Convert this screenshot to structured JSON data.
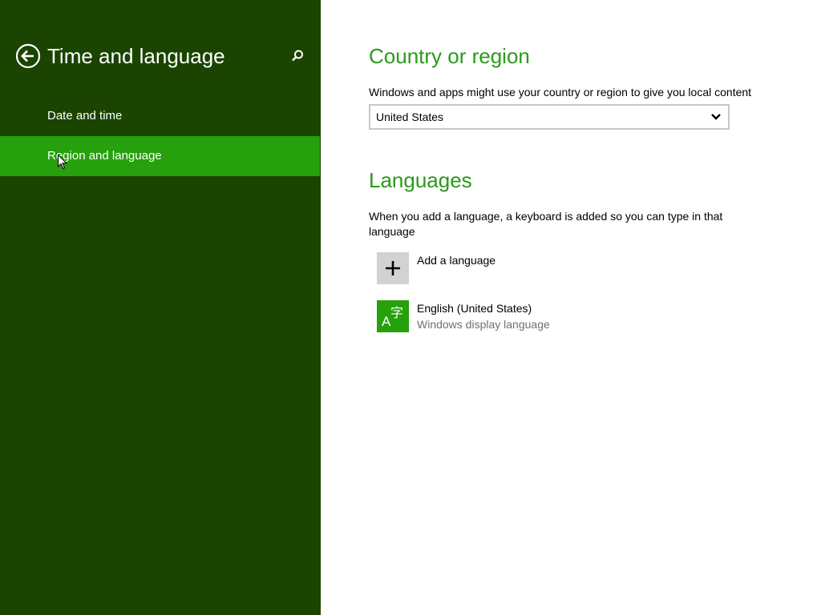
{
  "left_pane": {
    "title": "Time and language",
    "nav_items": [
      {
        "label": "Date and time",
        "selected": false
      },
      {
        "label": "Region and language",
        "selected": true
      }
    ]
  },
  "country_section": {
    "heading": "Country or region",
    "description": "Windows and apps might use your country or region to give you local content",
    "selected_country": "United States"
  },
  "languages_section": {
    "heading": "Languages",
    "description": "When you add a language, a keyboard is added so you can type in that language",
    "add_language_label": "Add a language",
    "languages": [
      {
        "name": "English (United States)",
        "subtitle": "Windows display language",
        "tile_glyph_a": "A",
        "tile_glyph_b": "字"
      }
    ]
  },
  "colors": {
    "left_pane_bg": "#1a4400",
    "selected_item_bg": "#26a00d",
    "heading_green": "#2a9a1a",
    "secondary_text": "#707070"
  },
  "icons": {
    "back": "back-arrow-circle-icon",
    "search": "search-icon",
    "dropdown": "chevron-down-icon",
    "add": "plus-icon",
    "language": "language-glyph-icon",
    "cursor": "mouse-pointer-icon"
  }
}
